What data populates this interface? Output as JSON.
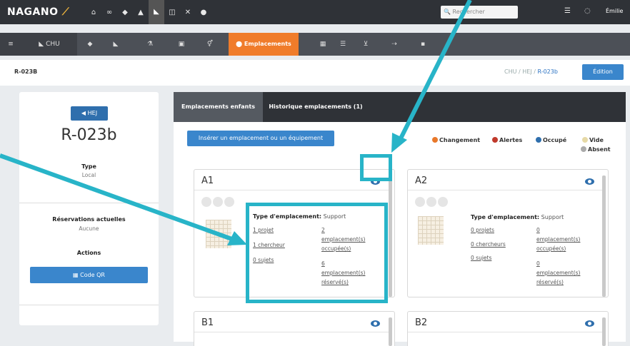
{
  "topbar": {
    "brand": "NAGANO",
    "search_placeholder": "Rechercher",
    "user": "Émilie"
  },
  "secbar": {
    "chu_label": "CHU",
    "active_label": "Emplacements"
  },
  "page": {
    "title": "R-023B",
    "breadcrumb": [
      "CHU",
      "HEJ",
      "R-023b"
    ],
    "edit_label": "Édition"
  },
  "left": {
    "back_label": "HEJ",
    "room": "R-023b",
    "type_label": "Type",
    "type_value": "Local",
    "reservations_label": "Réservations actuelles",
    "reservations_value": "Aucune",
    "actions_label": "Actions",
    "qr_label": "Code QR"
  },
  "tabs": {
    "children": "Emplacements enfants",
    "history": "Historique emplacements (1)"
  },
  "insert_label": "Insérer un emplacement ou un équipement",
  "legend": {
    "change": "Changement",
    "alerts": "Alertes",
    "occupied": "Occupé",
    "empty": "Vide",
    "absent": "Absent",
    "colors": {
      "change": "#e8782a",
      "alerts": "#c0392b",
      "occupied": "#2f6fad",
      "empty": "#e6d9a6",
      "absent": "#aaaaaa"
    }
  },
  "cards": [
    {
      "name": "A1",
      "type_label": "Type d'emplacement:",
      "type_value": "Support",
      "projects": "1 projet",
      "researchers": "1 chercheur",
      "subjects": "0 sujets",
      "occupied_count": "2",
      "occupied_l1": "emplacement(s)",
      "occupied_l2": "occupée(s)",
      "reserved_count": "6",
      "reserved_l1": "emplacement(s)",
      "reserved_l2": "réservé(s)"
    },
    {
      "name": "A2",
      "type_label": "Type d'emplacement:",
      "type_value": "Support",
      "projects": "0 projets",
      "researchers": "0 chercheurs",
      "subjects": "0 sujets",
      "occupied_count": "0",
      "occupied_l1": "emplacement(s)",
      "occupied_l2": "occupée(s)",
      "reserved_count": "0",
      "reserved_l1": "emplacement(s)",
      "reserved_l2": "réservé(s)"
    },
    {
      "name": "B1"
    },
    {
      "name": "B2"
    }
  ]
}
